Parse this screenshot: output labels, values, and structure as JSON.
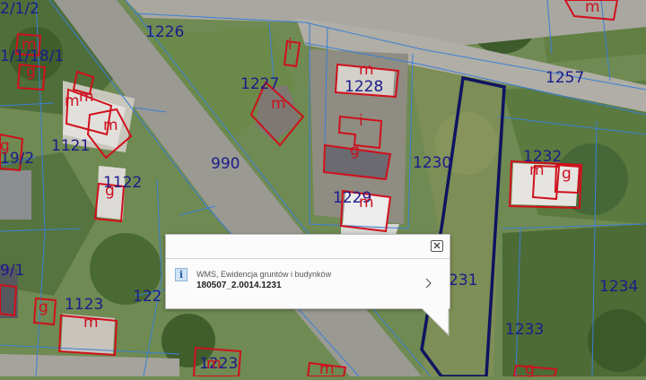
{
  "parcel_labels": [
    "2/1/2",
    "1226",
    "1/1/18/1",
    "1227",
    "1228",
    "1121",
    "990",
    "1230",
    "1257",
    "1232",
    "19/2",
    "1122",
    "1229",
    "1234",
    "9/1",
    "122",
    "231",
    "1123",
    "1233",
    "1223"
  ],
  "building_symbols": [
    "m",
    "m",
    "g",
    "m",
    "m",
    "m",
    "m",
    "g",
    "i",
    "m",
    "i",
    "g",
    "g",
    "m",
    "m",
    "g",
    "m",
    "g",
    "m",
    "m",
    "g"
  ],
  "popup": {
    "source": "WMS, Ewidencja gruntów i budynków",
    "parcel_id": "180507_2.0014.1231"
  },
  "colors": {
    "parcel_boundary": "#3b7fd6",
    "building": "#d0101c",
    "selected_parcel": "#0f1460",
    "label": "#1b1b8a"
  },
  "icons": [
    "close-icon",
    "info-icon",
    "chevron-right-icon"
  ]
}
